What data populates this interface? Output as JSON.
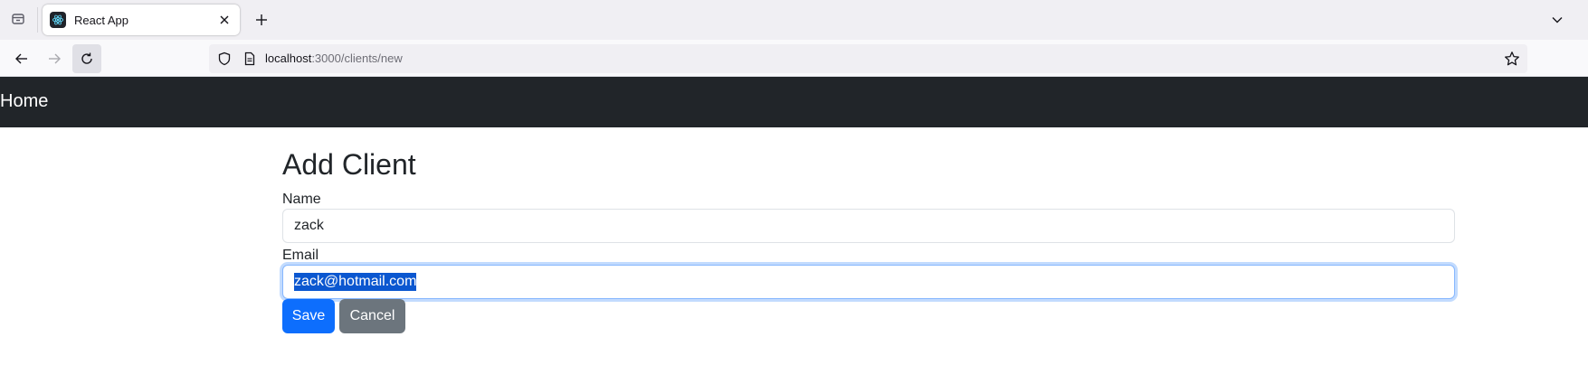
{
  "browser": {
    "tab": {
      "title": "React App"
    },
    "url": {
      "host": "localhost",
      "path": ":3000/clients/new"
    }
  },
  "app": {
    "nav": {
      "home_label": "Home"
    },
    "page_title": "Add Client",
    "form": {
      "name": {
        "label": "Name",
        "value": "zack"
      },
      "email": {
        "label": "Email",
        "value": "zack@hotmail.com"
      },
      "save_label": "Save",
      "cancel_label": "Cancel"
    }
  },
  "colors": {
    "app_nav_bg": "#212529",
    "primary": "#0d6efd",
    "secondary": "#6c757d",
    "focus_ring": "#86b7fe"
  },
  "icons": [
    "tab-list-icon",
    "react-favicon-icon",
    "close-icon",
    "plus-icon",
    "chevron-down-icon",
    "back-arrow-icon",
    "forward-arrow-icon",
    "reload-icon",
    "shield-icon",
    "page-icon",
    "star-icon"
  ]
}
